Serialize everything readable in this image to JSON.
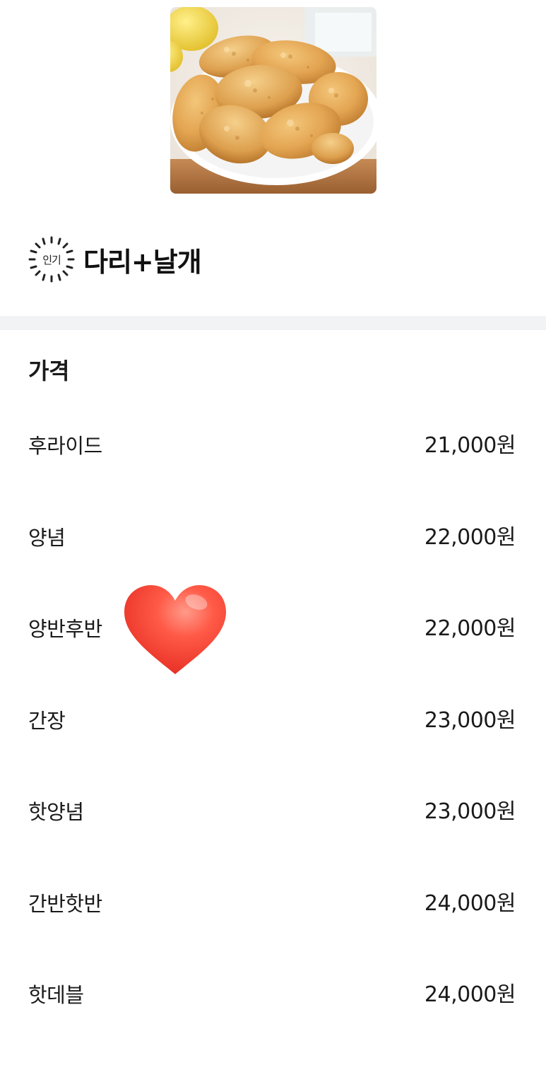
{
  "menu_item": {
    "badge": "인기",
    "title": "다리+날개"
  },
  "price_section": {
    "title": "가격",
    "items": [
      {
        "name": "후라이드",
        "price": "21,000원"
      },
      {
        "name": "양념",
        "price": "22,000원"
      },
      {
        "name": "양반후반",
        "price": "22,000원"
      },
      {
        "name": "간장",
        "price": "23,000원"
      },
      {
        "name": "핫양념",
        "price": "23,000원"
      },
      {
        "name": "간반핫반",
        "price": "24,000원"
      },
      {
        "name": "핫데블",
        "price": "24,000원"
      }
    ]
  },
  "colors": {
    "heart": "#ff4a3d",
    "divider": "#f2f3f5"
  },
  "icons": {
    "badge": "popular-burst-icon",
    "sticker": "heart-icon"
  }
}
